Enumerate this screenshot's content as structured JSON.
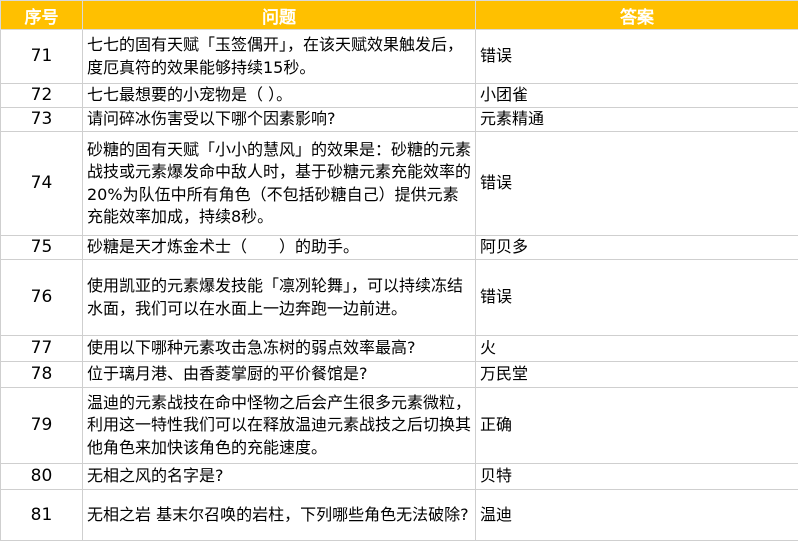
{
  "header": {
    "num": "序号",
    "question": "问题",
    "answer": "答案"
  },
  "rows": [
    {
      "num": "71",
      "question": "七七的固有天赋「玉签偶开」，在该天赋效果触发后，度厄真符的效果能够持续15秒。",
      "answer": "错误"
    },
    {
      "num": "72",
      "question": "七七最想要的小宠物是（ ）。",
      "answer": "小团雀"
    },
    {
      "num": "73",
      "question": "请问碎冰伤害受以下哪个因素影响?",
      "answer": "元素精通"
    },
    {
      "num": "74",
      "question": "砂糖的固有天赋「小小的慧风」的效果是：砂糖的元素战技或元素爆发命中敌人时，基于砂糖元素充能效率的20%为队伍中所有角色（不包括砂糖自己）提供元素充能效率加成，持续8秒。",
      "answer": "错误"
    },
    {
      "num": "75",
      "question": "砂糖是天才炼金术士（　　）的助手。",
      "answer": "阿贝多"
    },
    {
      "num": "76",
      "question": "使用凯亚的元素爆发技能「凛冽轮舞」，可以持续冻结水面，我们可以在水面上一边奔跑一边前进。",
      "answer": "错误"
    },
    {
      "num": "77",
      "question": "使用以下哪种元素攻击急冻树的弱点效率最高?",
      "answer": "火"
    },
    {
      "num": "78",
      "question": "位于璃月港、由香菱掌厨的平价餐馆是?",
      "answer": "万民堂"
    },
    {
      "num": "79",
      "question": "温迪的元素战技在命中怪物之后会产生很多元素微粒，利用这一特性我们可以在释放温迪元素战技之后切换其他角色来加快该角色的充能速度。",
      "answer": "正确"
    },
    {
      "num": "80",
      "question": "无相之风的名字是?",
      "answer": "贝特"
    },
    {
      "num": "81",
      "question": "无相之岩 基末尔召唤的岩柱，下列哪些角色无法破除?",
      "answer": "温迪"
    }
  ]
}
